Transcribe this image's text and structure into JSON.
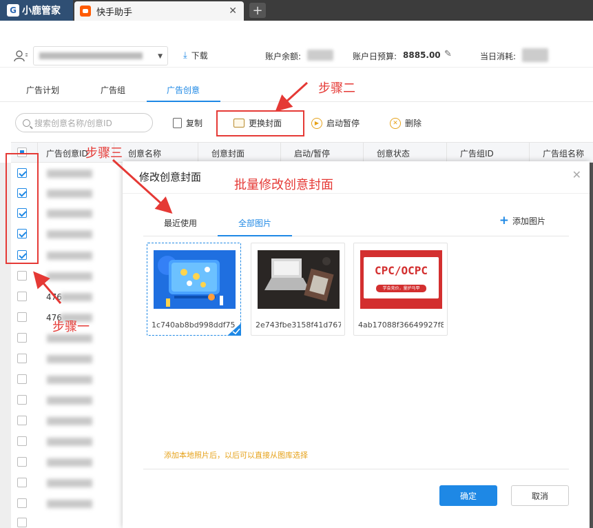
{
  "tabs": {
    "brand": "小鹿管家",
    "app_tab": "快手助手",
    "close": "✕",
    "new_tab": "+"
  },
  "header": {
    "download": "下载",
    "balance_label": "账户余额:",
    "daily_budget_label": "账户日预算:",
    "daily_budget_value": "8885.00",
    "today_spend_label": "当日消耗:"
  },
  "main_tabs": [
    "广告计划",
    "广告组",
    "广告创意"
  ],
  "toolbar": {
    "search_placeholder": "搜索创意名称/创意ID",
    "copy": "复制",
    "replace_cover": "更换封面",
    "toggle": "启动暂停",
    "delete": "删除"
  },
  "table": {
    "columns": [
      "广告创意ID",
      "创意名称",
      "创意封面",
      "启动/暂停",
      "创意状态",
      "广告组ID",
      "广告组名称"
    ],
    "visible_row_prefixes": [
      "476",
      "476"
    ]
  },
  "modal": {
    "title": "修改创意封面",
    "tabs": [
      "最近使用",
      "全部图片"
    ],
    "add_image": "添加图片",
    "images": [
      {
        "file_name": "1c740ab8bd998ddf75"
      },
      {
        "file_name": "2e743fbe3158f41d767"
      },
      {
        "file_name": "4ab17088f36649927f8"
      }
    ],
    "cpc_title": "CPC/OCPC",
    "cpc_subtitle": "学会竞价，量护马甲",
    "hint": "添加本地照片后，以后可以直接从图库选择",
    "confirm": "确定",
    "cancel": "取消"
  },
  "annotations": {
    "step1": "步骤一",
    "step2": "步骤二",
    "step3": "步骤三",
    "batch_title": "批量修改创意封面"
  },
  "colors": {
    "accent": "#1e88e5",
    "annotation": "#e53935",
    "warning": "#e6a21a"
  }
}
